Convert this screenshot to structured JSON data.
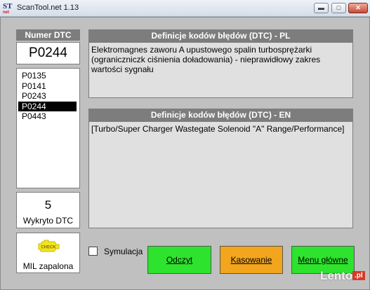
{
  "window": {
    "icon_text": "ST",
    "icon_subtext": "net",
    "title": "ScanTool.net 1.13",
    "minimize_icon": "minimize-icon",
    "maximize_icon": "maximize-icon",
    "close_icon": "close-icon",
    "minimize_glyph": "▬",
    "maximize_glyph": "□",
    "close_glyph": "✕"
  },
  "dtc": {
    "header": "Numer DTC",
    "current_code": "P0244",
    "list": [
      {
        "code": "P0135",
        "selected": false
      },
      {
        "code": "P0141",
        "selected": false
      },
      {
        "code": "P0243",
        "selected": false
      },
      {
        "code": "P0244",
        "selected": true
      },
      {
        "code": "P0443",
        "selected": false
      }
    ],
    "count": "5",
    "count_label": "Wykryto DTC"
  },
  "mil": {
    "icon": "check-engine-icon",
    "icon_text": "CHECK",
    "icon_color": "#f2e51d",
    "label": "MIL zapalona"
  },
  "definitions": {
    "pl": {
      "header": "Definicje kodów błędów (DTC) - PL",
      "text": "Elektromagnes zaworu A upustowego spalin turbosprężarki (ograniczniczk ciśnienia doładowania) - nieprawidłowy zakres wartości sygnału"
    },
    "en": {
      "header": "Definicje kodów błędów (DTC) - EN",
      "text": "[Turbo/Super Charger Wastegate Solenoid \"A\" Range/Performance]"
    }
  },
  "controls": {
    "simulation_label": "Symulacja",
    "simulation_checked": false,
    "read_button": "Odczyt",
    "clear_button": "Kasowanie",
    "menu_button": "Menu główne"
  },
  "colors": {
    "panel_header": "#7d7d7d",
    "frame": "#c0c0c0",
    "green_button": "#2ee32e",
    "orange_button": "#f2a51d"
  },
  "watermark": {
    "text": "Lento",
    "suffix": ".pl"
  }
}
